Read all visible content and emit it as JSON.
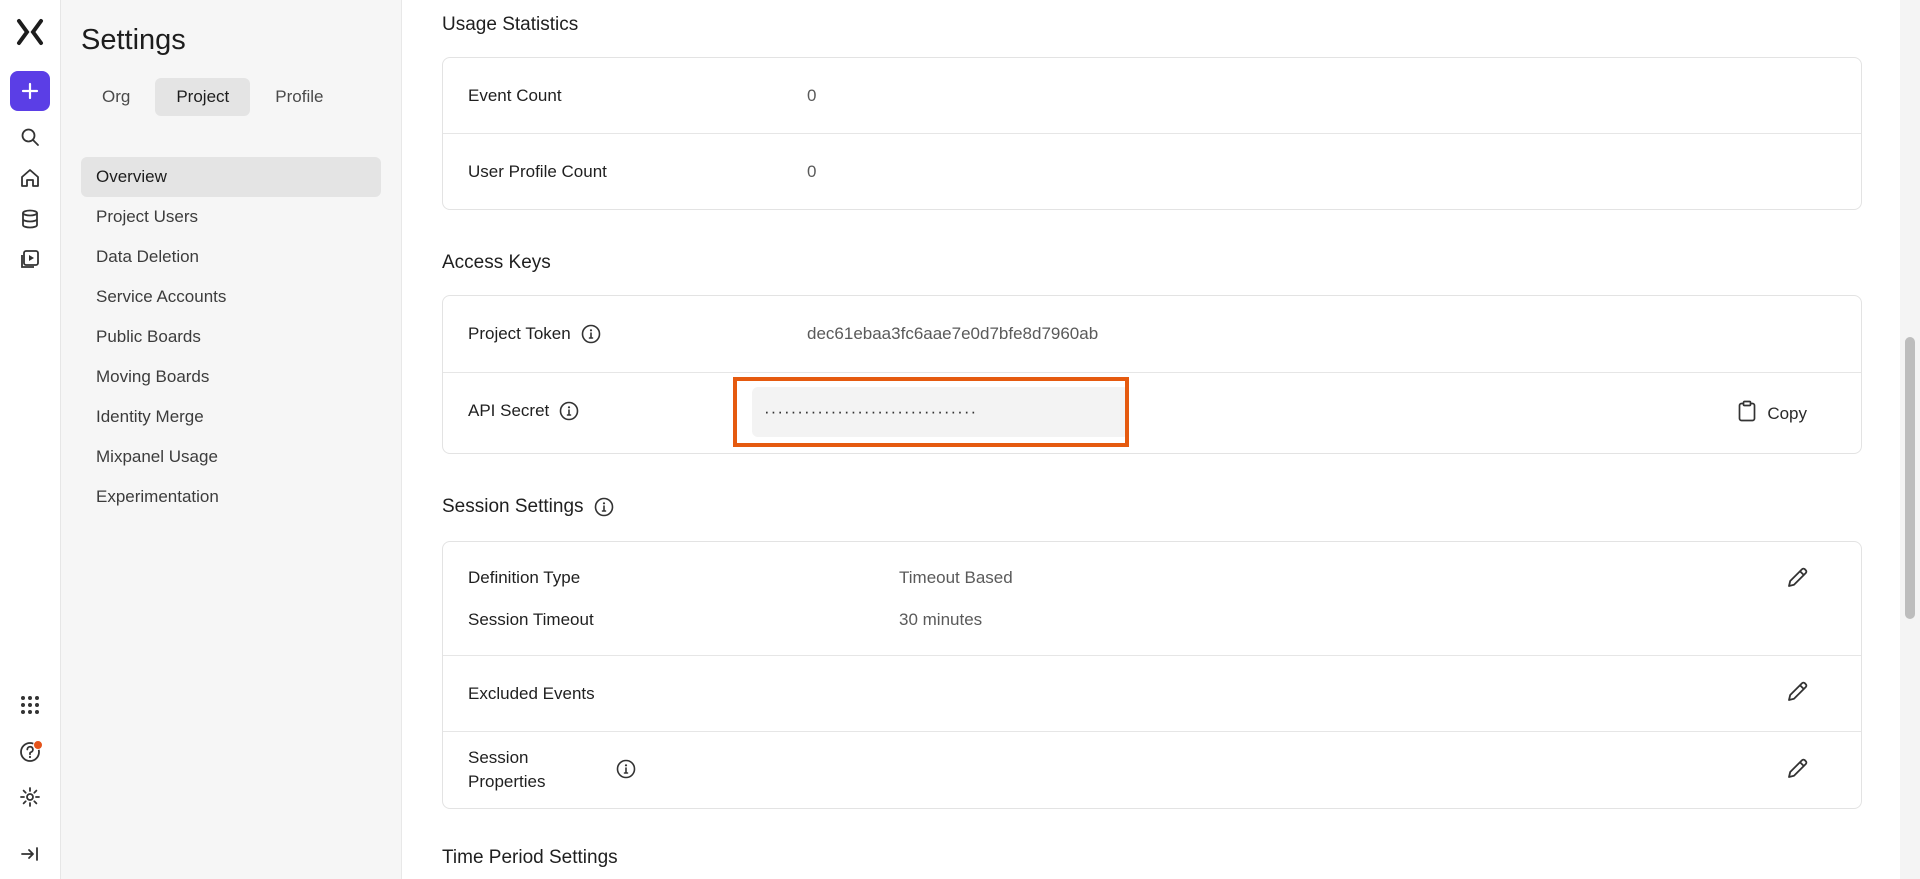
{
  "rail": {
    "icons": [
      "mixpanel-logo",
      "plus-icon",
      "search-icon",
      "home-icon",
      "database-icon",
      "replay-icon",
      "apps-grid-icon",
      "help-icon",
      "gear-icon",
      "collapse-icon"
    ]
  },
  "sidebar": {
    "title": "Settings",
    "tabs": [
      {
        "label": "Org"
      },
      {
        "label": "Project"
      },
      {
        "label": "Profile"
      }
    ],
    "items": [
      {
        "label": "Overview"
      },
      {
        "label": "Project Users"
      },
      {
        "label": "Data Deletion"
      },
      {
        "label": "Service Accounts"
      },
      {
        "label": "Public Boards"
      },
      {
        "label": "Moving Boards"
      },
      {
        "label": "Identity Merge"
      },
      {
        "label": "Mixpanel Usage"
      },
      {
        "label": "Experimentation"
      }
    ]
  },
  "usage": {
    "title": "Usage Statistics",
    "rows": [
      {
        "label": "Event Count",
        "value": "0"
      },
      {
        "label": "User Profile Count",
        "value": "0"
      }
    ]
  },
  "access_keys": {
    "title": "Access Keys",
    "token_label": "Project Token",
    "token_value": "dec61ebaa3fc6aae7e0d7bfe8d7960ab",
    "secret_label": "API Secret",
    "secret_value": "································",
    "copy_label": "Copy"
  },
  "session": {
    "title": "Session Settings",
    "definition_label": "Definition Type",
    "definition_value": "Timeout Based",
    "timeout_label": "Session Timeout",
    "timeout_value": "30 minutes",
    "excluded_label": "Excluded Events",
    "properties_label": "Session Properties"
  },
  "time_period": {
    "title": "Time Period Settings"
  },
  "colors": {
    "accent": "#5b3ee6",
    "highlight": "#e55a0f",
    "notification": "#e5531a"
  }
}
